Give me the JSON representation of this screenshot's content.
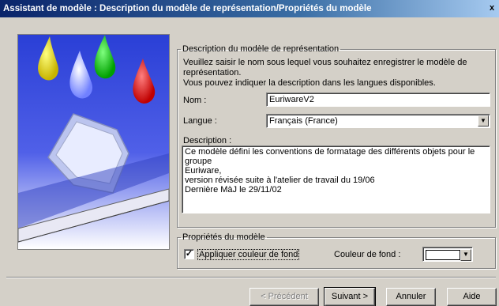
{
  "window": {
    "title": "Assistant de modèle : Description du modèle de représentation/Propriétés du modèle"
  },
  "group_description": {
    "legend": "Description du modèle de représentation",
    "intro_line1": "Veuillez saisir le nom sous lequel vous souhaitez enregistrer le modèle de",
    "intro_line2": "représentation.",
    "intro_line3": "Vous pouvez indiquer la description dans les langues disponibles.",
    "nom_label": "Nom :",
    "nom_value": "EuriwareV2",
    "langue_label": "Langue :",
    "langue_value": "Français (France)",
    "description_label": "Description :",
    "description_lines": [
      "Ce modèle défini les conventions de formatage des différents objets pour le groupe",
      "Euriware,",
      "version révisée suite à l'atelier de travail du  19/06",
      "Dernière MàJ le 29/11/02"
    ]
  },
  "group_proprietes": {
    "legend": "Propriétés du modèle",
    "checkbox_label": "Appliquer couleur de fond",
    "checkbox_checked": true,
    "couleur_label": "Couleur de fond :",
    "couleur_value": "#ffffff"
  },
  "buttons": {
    "previous": "< Précédent",
    "next": "Suivant >",
    "cancel": "Annuler",
    "help": "Aide"
  }
}
